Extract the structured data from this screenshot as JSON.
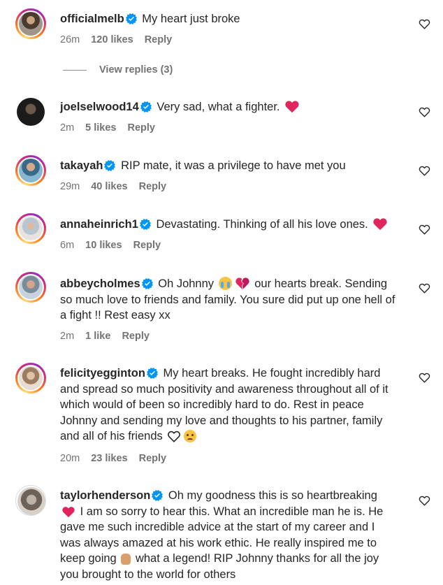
{
  "comments": [
    {
      "user": "officialmelb",
      "text": "My heart just broke",
      "time": "26m",
      "likes": "120 likes",
      "reply": "Reply"
    },
    {
      "user": "joelselwood14",
      "text": "Very sad, what a fighter.",
      "time": "2m",
      "likes": "5 likes",
      "reply": "Reply"
    },
    {
      "user": "takayah",
      "text": "RIP mate, it was a privilege to have met you",
      "time": "29m",
      "likes": "40 likes",
      "reply": "Reply"
    },
    {
      "user": "annaheinrich1",
      "text": "Devastating. Thinking of all his love ones.",
      "time": "6m",
      "likes": "10 likes",
      "reply": "Reply"
    },
    {
      "user": "abbeycholmes",
      "text_a": "Oh Johnny",
      "text_b": "our hearts break. Sending so much love to friends and family. You sure did put up one hell of a fight !! Rest easy xx",
      "time": "2m",
      "likes": "1 like",
      "reply": "Reply"
    },
    {
      "user": "felicityegginton",
      "text": "My heart breaks. He fought incredibly hard and spread so much positivity and awareness throughout all of it which would of been so incredibly hard to do. Rest in peace Johnny and sending my love and thoughts to his partner, family and all of his friends",
      "time": "20m",
      "likes": "23 likes",
      "reply": "Reply"
    },
    {
      "user": "taylorhenderson",
      "text_a": "Oh my goodness this is so heartbreaking",
      "text_b": "I am so sorry to hear this. What an incredible man he is. He gave me such incredible advice at the start of my career and I was always amazed at his work ethic. He really inspired me to keep going",
      "text_c": "what a legend! RIP Johnny thanks for all the joy you brought to the world for others"
    }
  ],
  "view_replies": "View replies (3)",
  "icons": {
    "verified": "verified-badge-icon",
    "like": "heart-outline-icon",
    "red_heart": "red-heart-emoji",
    "accent": "#0095f6",
    "heart_red": "#e0245e"
  }
}
